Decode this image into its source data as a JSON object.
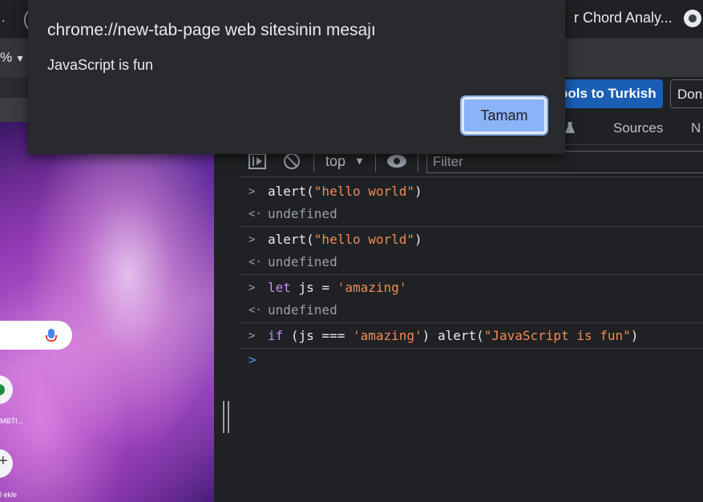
{
  "browser": {
    "tab_title_right": "r Chord Analy...",
    "zoom": "%",
    "tab_dot": "."
  },
  "page": {
    "shortcut_label_1": "MBTI...",
    "shortcut_label_2": "l ekle",
    "plus": "+"
  },
  "devtools": {
    "language_button": "ools to Turkish",
    "language_dont": "Don",
    "tabs": {
      "sources": "Sources",
      "next": "N"
    },
    "toolbar": {
      "context": "top",
      "filter_placeholder": "Filter"
    },
    "console_lines": [
      {
        "type": "input",
        "text": "alert(\"hello world\")"
      },
      {
        "type": "output",
        "text": "undefined"
      },
      {
        "type": "input",
        "text": "alert(\"hello world\")"
      },
      {
        "type": "output",
        "text": "undefined"
      },
      {
        "type": "input",
        "text": "let js = 'amazing'"
      },
      {
        "type": "output",
        "text": "undefined"
      },
      {
        "type": "input",
        "text": "if (js === 'amazing') alert(\"JavaScript is fun\")"
      }
    ],
    "segments": {
      "l1_fn": "alert(",
      "l1_str": "\"hello world\"",
      "l1_end": ")",
      "l3_fn": "alert(",
      "l3_str": "\"hello world\"",
      "l3_end": ")",
      "l5_kw": "let",
      "l5_mid": " js = ",
      "l5_str": "'amazing'",
      "l7_kw": "if",
      "l7_a": " (js === ",
      "l7_s1": "'amazing'",
      "l7_b": ") alert(",
      "l7_s2": "\"JavaScript is fun\"",
      "l7_c": ")",
      "undef": "undefined"
    },
    "arrows": {
      "input": ">",
      "output": "<·",
      "prompt": ">"
    }
  },
  "dialog": {
    "title": "chrome://new-tab-page web sitesinin mesajı",
    "message": "JavaScript is fun",
    "ok_label": "Tamam"
  },
  "colors": {
    "accent": "#8ab4f8",
    "string": "#f28b54",
    "keyword": "#c58af9",
    "prompt": "#4d90fe"
  }
}
